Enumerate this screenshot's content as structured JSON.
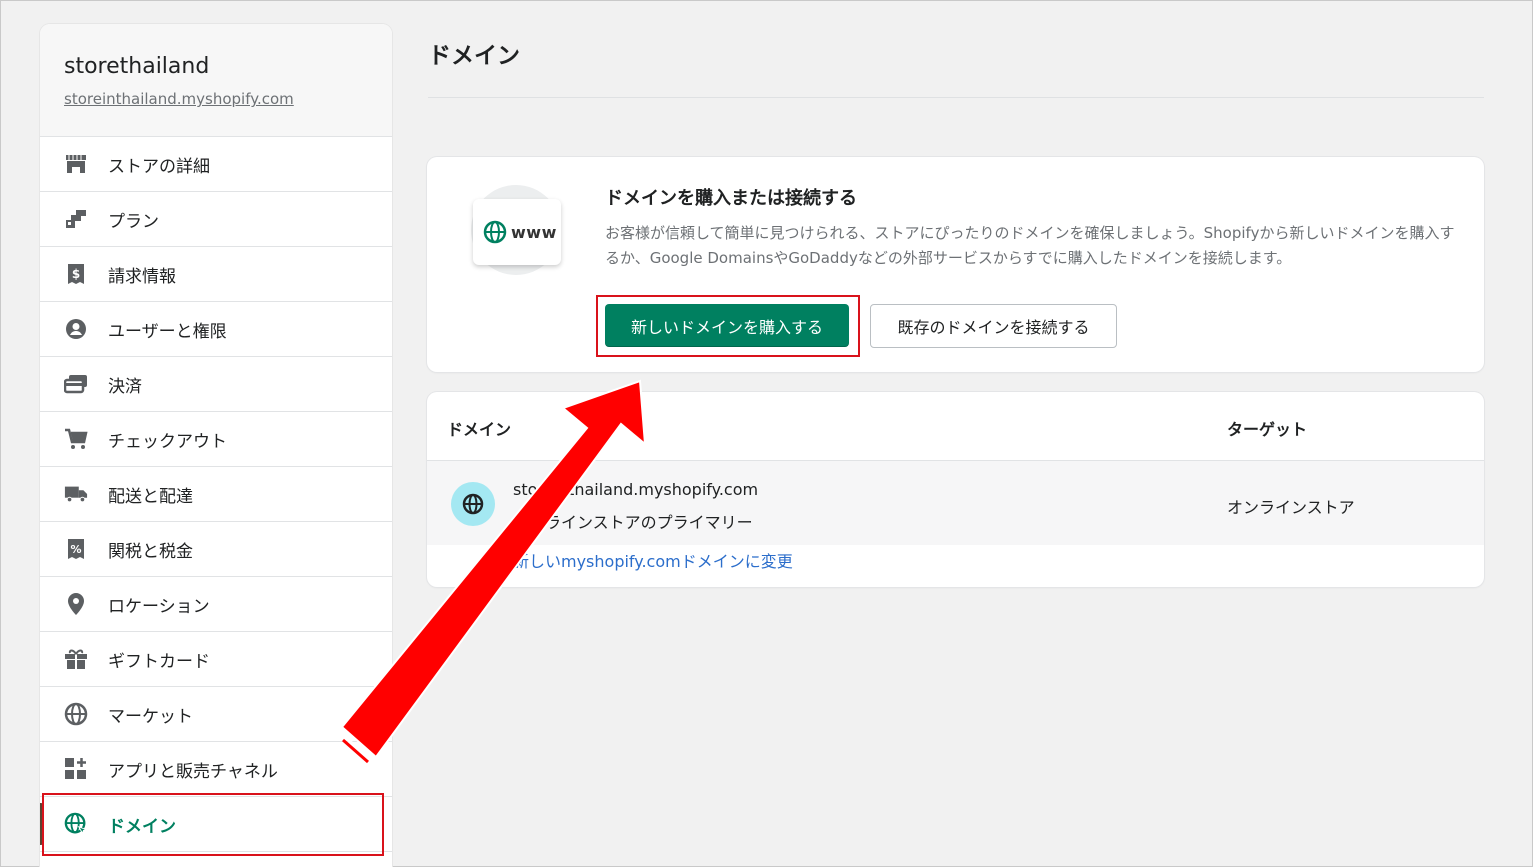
{
  "sidebar": {
    "store_name": "storethailand",
    "store_url": "storeinthailand.myshopify.com",
    "items": [
      {
        "label": "ストアの詳細",
        "icon": "store-icon"
      },
      {
        "label": "プラン",
        "icon": "plan-icon"
      },
      {
        "label": "請求情報",
        "icon": "billing-icon"
      },
      {
        "label": "ユーザーと権限",
        "icon": "user-icon"
      },
      {
        "label": "決済",
        "icon": "payment-icon"
      },
      {
        "label": "チェックアウト",
        "icon": "cart-icon"
      },
      {
        "label": "配送と配達",
        "icon": "truck-icon"
      },
      {
        "label": "関税と税金",
        "icon": "tax-icon"
      },
      {
        "label": "ロケーション",
        "icon": "location-icon"
      },
      {
        "label": "ギフトカード",
        "icon": "gift-icon"
      },
      {
        "label": "マーケット",
        "icon": "globe-market-icon"
      },
      {
        "label": "アプリと販売チャネル",
        "icon": "apps-icon"
      },
      {
        "label": "ドメイン",
        "icon": "domain-globe-icon",
        "active": true
      }
    ]
  },
  "main": {
    "title": "ドメイン",
    "buy_card": {
      "illustration_text": "www",
      "heading": "ドメインを購入または接続する",
      "description": "お客様が信頼して簡単に見つけられる、ストアにぴったりのドメインを確保しましょう。Shopifyから新しいドメインを購入するか、Google DomainsやGoDaddyなどの外部サービスからすでに購入したドメインを接続します。",
      "primary_button": "新しいドメインを購入する",
      "secondary_button": "既存のドメインを接続する"
    },
    "table": {
      "headers": {
        "domain": "ドメイン",
        "target": "ターゲット"
      },
      "rows": [
        {
          "domain": "storeinthailand.myshopify.com",
          "subtitle": "オンラインストアのプライマリー",
          "target": "オンラインストア"
        }
      ],
      "change_link": "新しいmyshopify.comドメインに変更"
    }
  },
  "colors": {
    "primary": "#008060",
    "link": "#2c6ecb",
    "highlight": "#d9121b",
    "arrow": "#ff0000"
  }
}
